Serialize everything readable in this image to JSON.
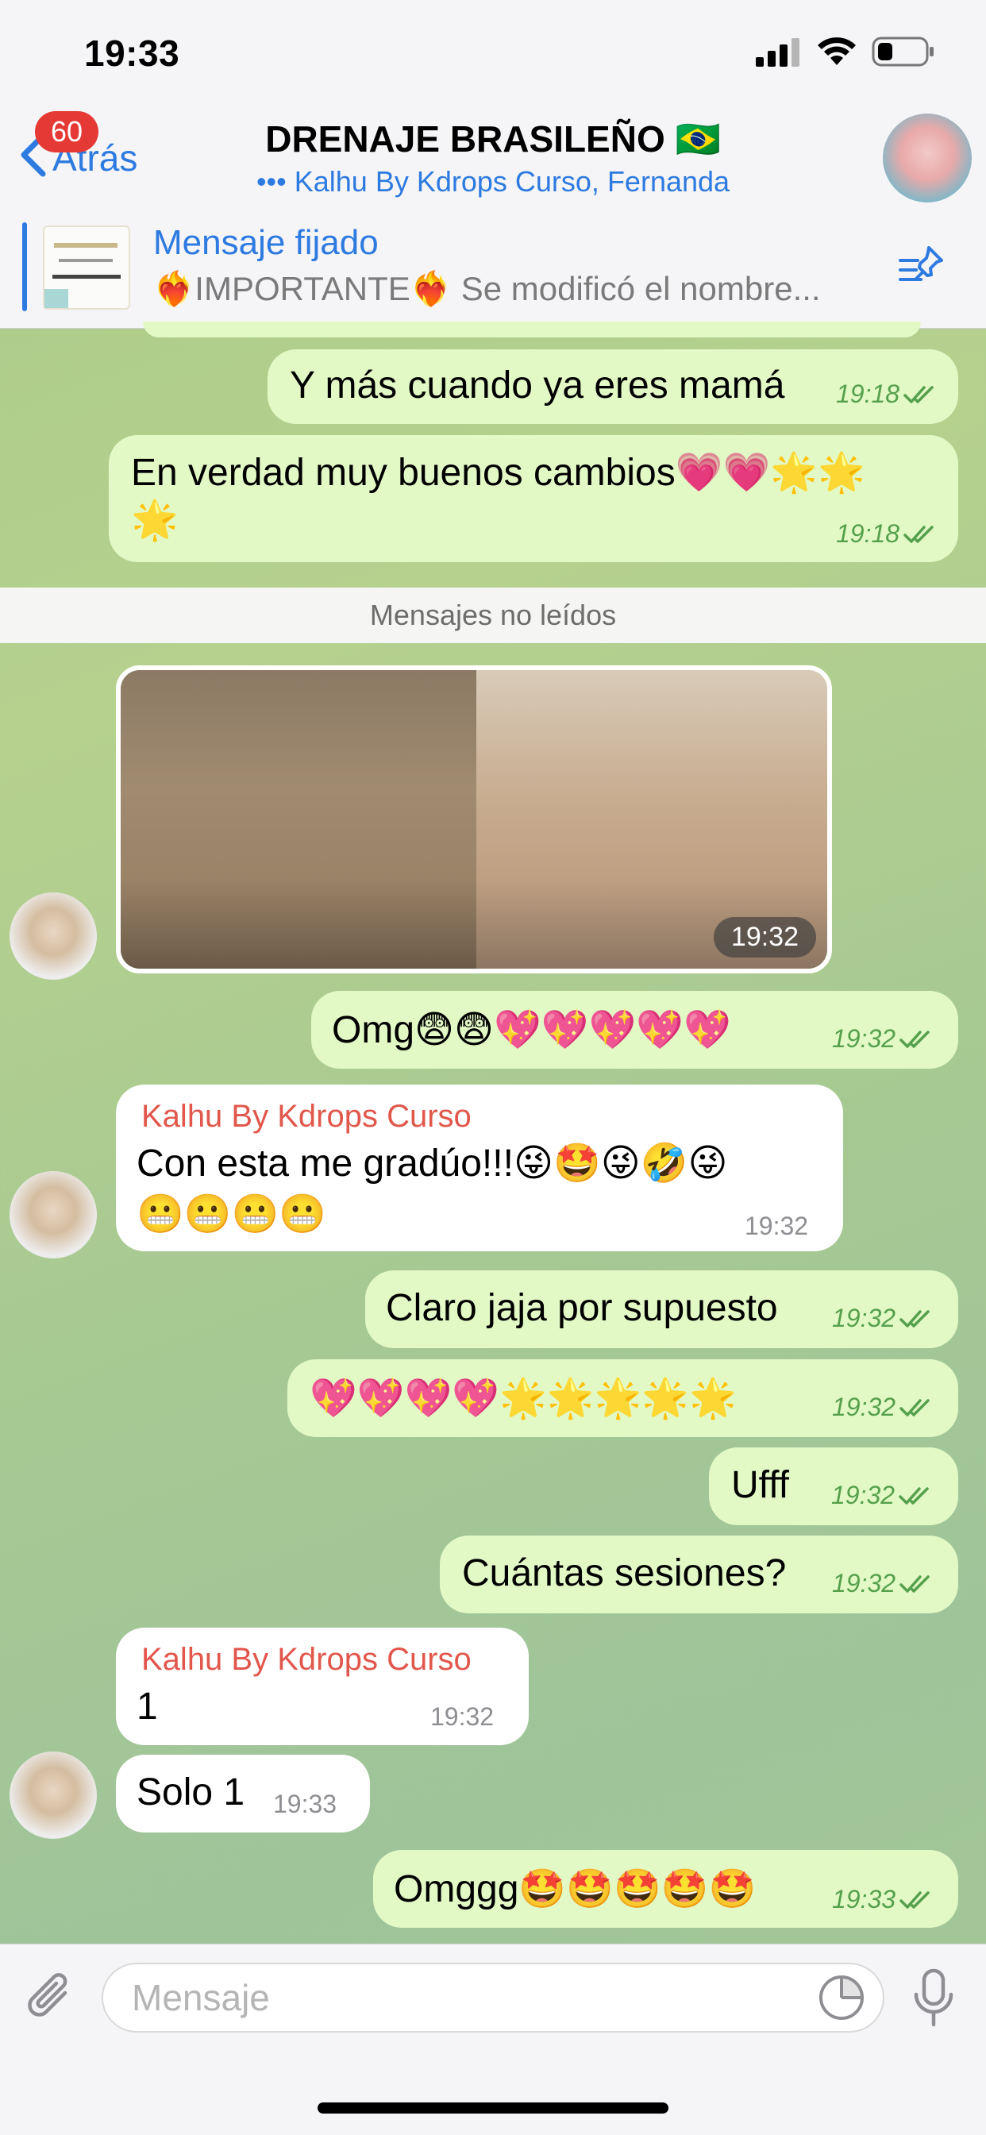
{
  "status_bar": {
    "time": "19:33"
  },
  "header": {
    "back_label": "Atrás",
    "unread_badge": "60",
    "title": "DRENAJE BRASILEÑO 🇧🇷",
    "subtitle": "••• Kalhu By Kdrops Curso, Fernanda"
  },
  "pinned": {
    "label": "Mensaje fijado",
    "text": "❤️‍🔥IMPORTANTE❤️‍🔥 Se modificó el nombre..."
  },
  "messages": [
    {
      "text": "Y más cuando ya eres mamá",
      "time": "19:18"
    },
    {
      "text_line1": "En verdad muy buenos cambios💗💗🌟🌟",
      "text_line2": "🌟",
      "time": "19:18"
    },
    {
      "unread_divider": "Mensajes no leídos"
    },
    {
      "photo_time": "19:32"
    },
    {
      "text": "Omg😨😨💖💖💖💖💖",
      "time": "19:32"
    },
    {
      "sender": "Kalhu By Kdrops Curso",
      "text_line1": "Con esta me gradúo!!!😜🤩😜🤣😜",
      "text_line2": "😬😬😬😬",
      "time": "19:32"
    },
    {
      "text": "Claro jaja por supuesto",
      "time": "19:32"
    },
    {
      "text": "💖💖💖💖🌟🌟🌟🌟🌟",
      "time": "19:32"
    },
    {
      "text": "Ufff",
      "time": "19:32"
    },
    {
      "text": "Cuántas sesiones?",
      "time": "19:32"
    },
    {
      "sender": "Kalhu By Kdrops Curso",
      "text": "1",
      "time": "19:32"
    },
    {
      "text": "Solo 1",
      "time": "19:33"
    },
    {
      "text": "Omggg🤩🤩🤩🤩🤩",
      "time": "19:33"
    }
  ],
  "input": {
    "placeholder": "Mensaje"
  },
  "colors": {
    "accent": "#2d7ae0",
    "outgoing_bubble": "#e2f9c6",
    "incoming_bubble": "#ffffff",
    "sender_name": "#e2574c",
    "badge": "#e53935"
  },
  "icons": [
    "back-chevron-icon",
    "pin-list-icon",
    "attach-icon",
    "sticker-icon",
    "microphone-icon",
    "read-checkmark-icon",
    "wifi-icon",
    "battery-icon",
    "signal-icon"
  ]
}
